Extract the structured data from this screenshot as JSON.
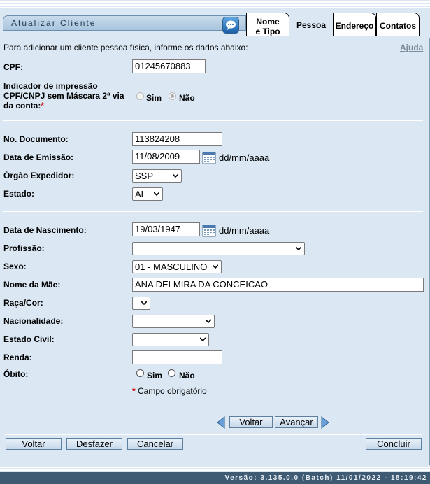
{
  "header": {
    "title": "Atualizar Cliente"
  },
  "tabs": [
    {
      "line1": "Nome",
      "line2": "e Tipo"
    },
    {
      "label": "Pessoa"
    },
    {
      "label": "Endereço"
    },
    {
      "label": "Contatos"
    }
  ],
  "intro": "Para adicionar um cliente pessoa física, informe os dados abaixo:",
  "help_link": "Ajuda",
  "cpf": {
    "label": "CPF:",
    "value": "01245670883"
  },
  "indicador": {
    "label_line1": "Indicador de impressão",
    "label_line2": "CPF/CNPJ sem Máscara 2ª via",
    "label_line3": "da conta:",
    "required_mark": "*",
    "opt_sim": "Sim",
    "opt_nao": "Não"
  },
  "documento": {
    "label": "No. Documento:",
    "value": "113824208"
  },
  "emissao": {
    "label": "Data de Emissão:",
    "value": "11/08/2009",
    "format": "dd/mm/aaaa"
  },
  "orgao": {
    "label": "Órgão Expedidor:",
    "value": "SSP"
  },
  "estado": {
    "label": "Estado:",
    "value": "AL"
  },
  "nascimento": {
    "label": "Data de Nascimento:",
    "value": "19/03/1947",
    "format": "dd/mm/aaaa"
  },
  "profissao": {
    "label": "Profissão:",
    "value": ""
  },
  "sexo": {
    "label": "Sexo:",
    "value": "01 - MASCULINO"
  },
  "mae": {
    "label": "Nome da Mãe:",
    "value": "ANA DELMIRA DA CONCEICAO"
  },
  "raca": {
    "label": "Raça/Cor:",
    "value": ""
  },
  "nacionalidade": {
    "label": "Nacionalidade:",
    "value": ""
  },
  "estado_civil": {
    "label": "Estado Civil:",
    "value": ""
  },
  "renda": {
    "label": "Renda:",
    "value": ""
  },
  "obito": {
    "label": "Óbito:",
    "opt_sim": "Sim",
    "opt_nao": "Não"
  },
  "required_note": {
    "mark": "*",
    "text": " Campo obrigatório"
  },
  "nav": {
    "voltar": "Voltar",
    "avancar": "Avançar"
  },
  "actions": {
    "voltar": "Voltar",
    "desfazer": "Desfazer",
    "cancelar": "Cancelar",
    "concluir": "Concluir"
  },
  "footer": {
    "version": "Versão: 3.135.0.0 (Batch) 11/01/2022 - 18:19:42"
  },
  "colors": {
    "background": "#dbe8f4",
    "footer": "#3f5a73",
    "accent": "#1d5fa8",
    "required": "#cc0000"
  }
}
